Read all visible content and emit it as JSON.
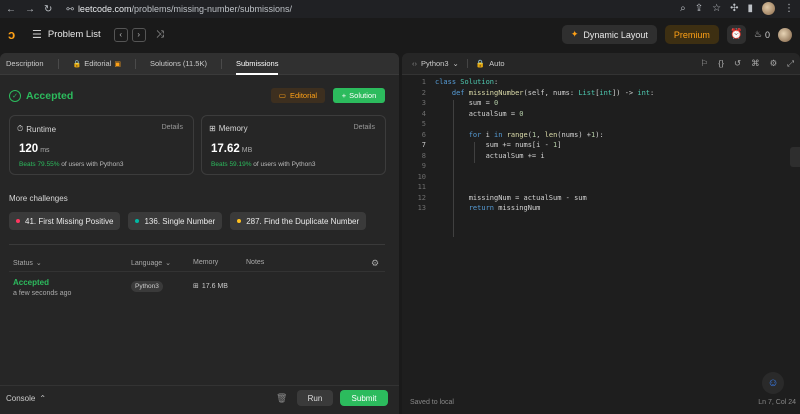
{
  "browser": {
    "url_host": "leetcode.com",
    "url_path": "/problems/missing-number/submissions/"
  },
  "header": {
    "problem_list": "Problem List",
    "dynamic_layout": "Dynamic Layout",
    "premium": "Premium",
    "streak_count": "0"
  },
  "tabs": [
    {
      "label": "Description"
    },
    {
      "label": "Editorial"
    },
    {
      "label": "Solutions (11.5K)"
    },
    {
      "label": "Submissions"
    }
  ],
  "result": {
    "status": "Accepted",
    "editorial_btn": "Editorial",
    "solution_btn": "Solution"
  },
  "runtime": {
    "label": "Runtime",
    "details": "Details",
    "value": "120",
    "unit": "ms",
    "beats_prefix": "Beats",
    "beats_pct": "79.55%",
    "beats_suffix": "of users with Python3"
  },
  "memory": {
    "label": "Memory",
    "details": "Details",
    "value": "17.62",
    "unit": "MB",
    "beats_prefix": "Beats",
    "beats_pct": "59.19%",
    "beats_suffix": "of users with Python3"
  },
  "challenges": {
    "title": "More challenges",
    "items": [
      {
        "label": "41. First Missing Positive",
        "color": "#ff375f"
      },
      {
        "label": "136. Single Number",
        "color": "#00b8a3"
      },
      {
        "label": "287. Find the Duplicate Number",
        "color": "#ffc01e"
      }
    ]
  },
  "submissions": {
    "col_status": "Status",
    "col_language": "Language",
    "col_memory": "Memory",
    "col_notes": "Notes",
    "row": {
      "status": "Accepted",
      "time": "a few seconds ago",
      "language": "Python3",
      "memory": "17.6 MB"
    }
  },
  "console": {
    "label": "Console",
    "run": "Run",
    "submit": "Submit"
  },
  "editor": {
    "language": "Python3",
    "mode": "Auto",
    "saved": "Saved to local",
    "cursor": "Ln 7, Col 24",
    "line_numbers": [
      "1",
      "2",
      "3",
      "4",
      "5",
      "6",
      "7",
      "8",
      "9",
      "10",
      "11",
      "12",
      "13"
    ]
  },
  "colors": {
    "accent_green": "#2cbb5d",
    "accent_orange": "#ffa116"
  }
}
